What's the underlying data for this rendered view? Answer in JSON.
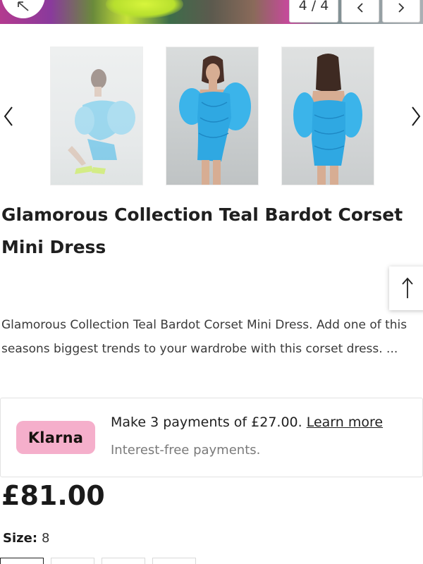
{
  "gallery": {
    "counter": "4 / 4",
    "prev_icon": "chevron-left-icon",
    "next_icon": "chevron-right-icon",
    "expand_icon": "expand-diagonal-icon",
    "thumbnail_count": 3
  },
  "product": {
    "title": "Glamorous Collection Teal Bardot Corset Mini Dress",
    "description": "Glamorous Collection Teal Bardot Corset Mini Dress. Add one of this seasons biggest trends to your wardrobe with this corset dress. ..."
  },
  "klarna": {
    "logo": "Klarna",
    "payments_text": "Make 3 payments of £27.00.",
    "learn_more": "Learn more",
    "subtext": "Interest-free payments.",
    "badge_color": "#f5afcb"
  },
  "price": "£81.00",
  "size": {
    "label": "Size:",
    "selected": "8"
  },
  "colors": {
    "dress": "#2fb0e6",
    "text": "#1f1f1f"
  }
}
